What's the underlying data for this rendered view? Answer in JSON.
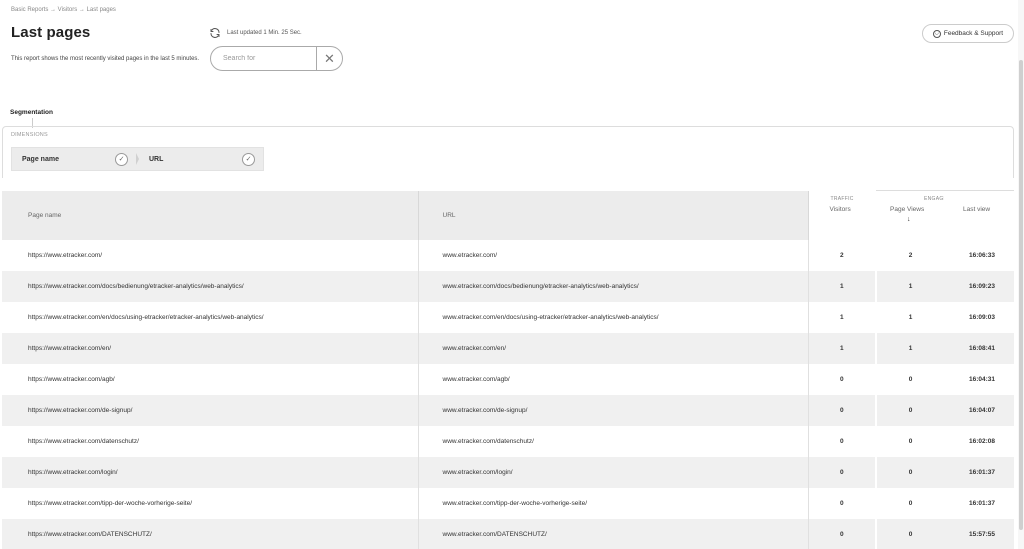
{
  "breadcrumb": "Basic Reports → Visitors → Last pages",
  "page_title": "Last pages",
  "description": "This report shows the most recently visited pages in the last 5 minutes.",
  "last_updated": "Last updated 1 Min. 25 Sec.",
  "search": {
    "placeholder": "Search for",
    "value": ""
  },
  "feedback_label": "Feedback & Support",
  "segmentation": {
    "label": "Segmentation",
    "dimensions_label": "DIMENSIONS",
    "dimensions": [
      "Page name",
      "URL"
    ]
  },
  "table": {
    "headers": {
      "page_name": "Page name",
      "url": "URL",
      "traffic_group": "TRAFFIC",
      "engagement_group": "ENGAGEMENT",
      "visitors": "Visitors",
      "page_views": "Page Views",
      "last_view": "Last view"
    },
    "sort_indicator": "↓",
    "rows": [
      {
        "page": "https://www.etracker.com/",
        "url": "www.etracker.com/",
        "visitors": "2",
        "views": "2",
        "last": "16:06:33"
      },
      {
        "page": "https://www.etracker.com/docs/bedienung/etracker-analytics/web-analytics/",
        "url": "www.etracker.com/docs/bedienung/etracker-analytics/web-analytics/",
        "visitors": "1",
        "views": "1",
        "last": "16:09:23"
      },
      {
        "page": "https://www.etracker.com/en/docs/using-etracker/etracker-analytics/web-analytics/",
        "url": "www.etracker.com/en/docs/using-etracker/etracker-analytics/web-analytics/",
        "visitors": "1",
        "views": "1",
        "last": "16:09:03"
      },
      {
        "page": "https://www.etracker.com/en/",
        "url": "www.etracker.com/en/",
        "visitors": "1",
        "views": "1",
        "last": "16:08:41"
      },
      {
        "page": "https://www.etracker.com/agb/",
        "url": "www.etracker.com/agb/",
        "visitors": "0",
        "views": "0",
        "last": "16:04:31"
      },
      {
        "page": "https://www.etracker.com/de-signup/",
        "url": "www.etracker.com/de-signup/",
        "visitors": "0",
        "views": "0",
        "last": "16:04:07"
      },
      {
        "page": "https://www.etracker.com/datenschutz/",
        "url": "www.etracker.com/datenschutz/",
        "visitors": "0",
        "views": "0",
        "last": "16:02:08"
      },
      {
        "page": "https://www.etracker.com/login/",
        "url": "www.etracker.com/login/",
        "visitors": "0",
        "views": "0",
        "last": "16:01:37"
      },
      {
        "page": "https://www.etracker.com/tipp-der-woche-vorherige-seite/",
        "url": "www.etracker.com/tipp-der-woche-vorherige-seite/",
        "visitors": "0",
        "views": "0",
        "last": "16:01:37"
      },
      {
        "page": "https://www.etracker.com/DATENSCHUTZ/",
        "url": "www.etracker.com/DATENSCHUTZ/",
        "visitors": "0",
        "views": "0",
        "last": "15:57:55"
      }
    ]
  },
  "icons": {
    "refresh": "refresh-icon",
    "clear": "close-icon",
    "feedback": "smile-icon",
    "check": "check-icon"
  }
}
